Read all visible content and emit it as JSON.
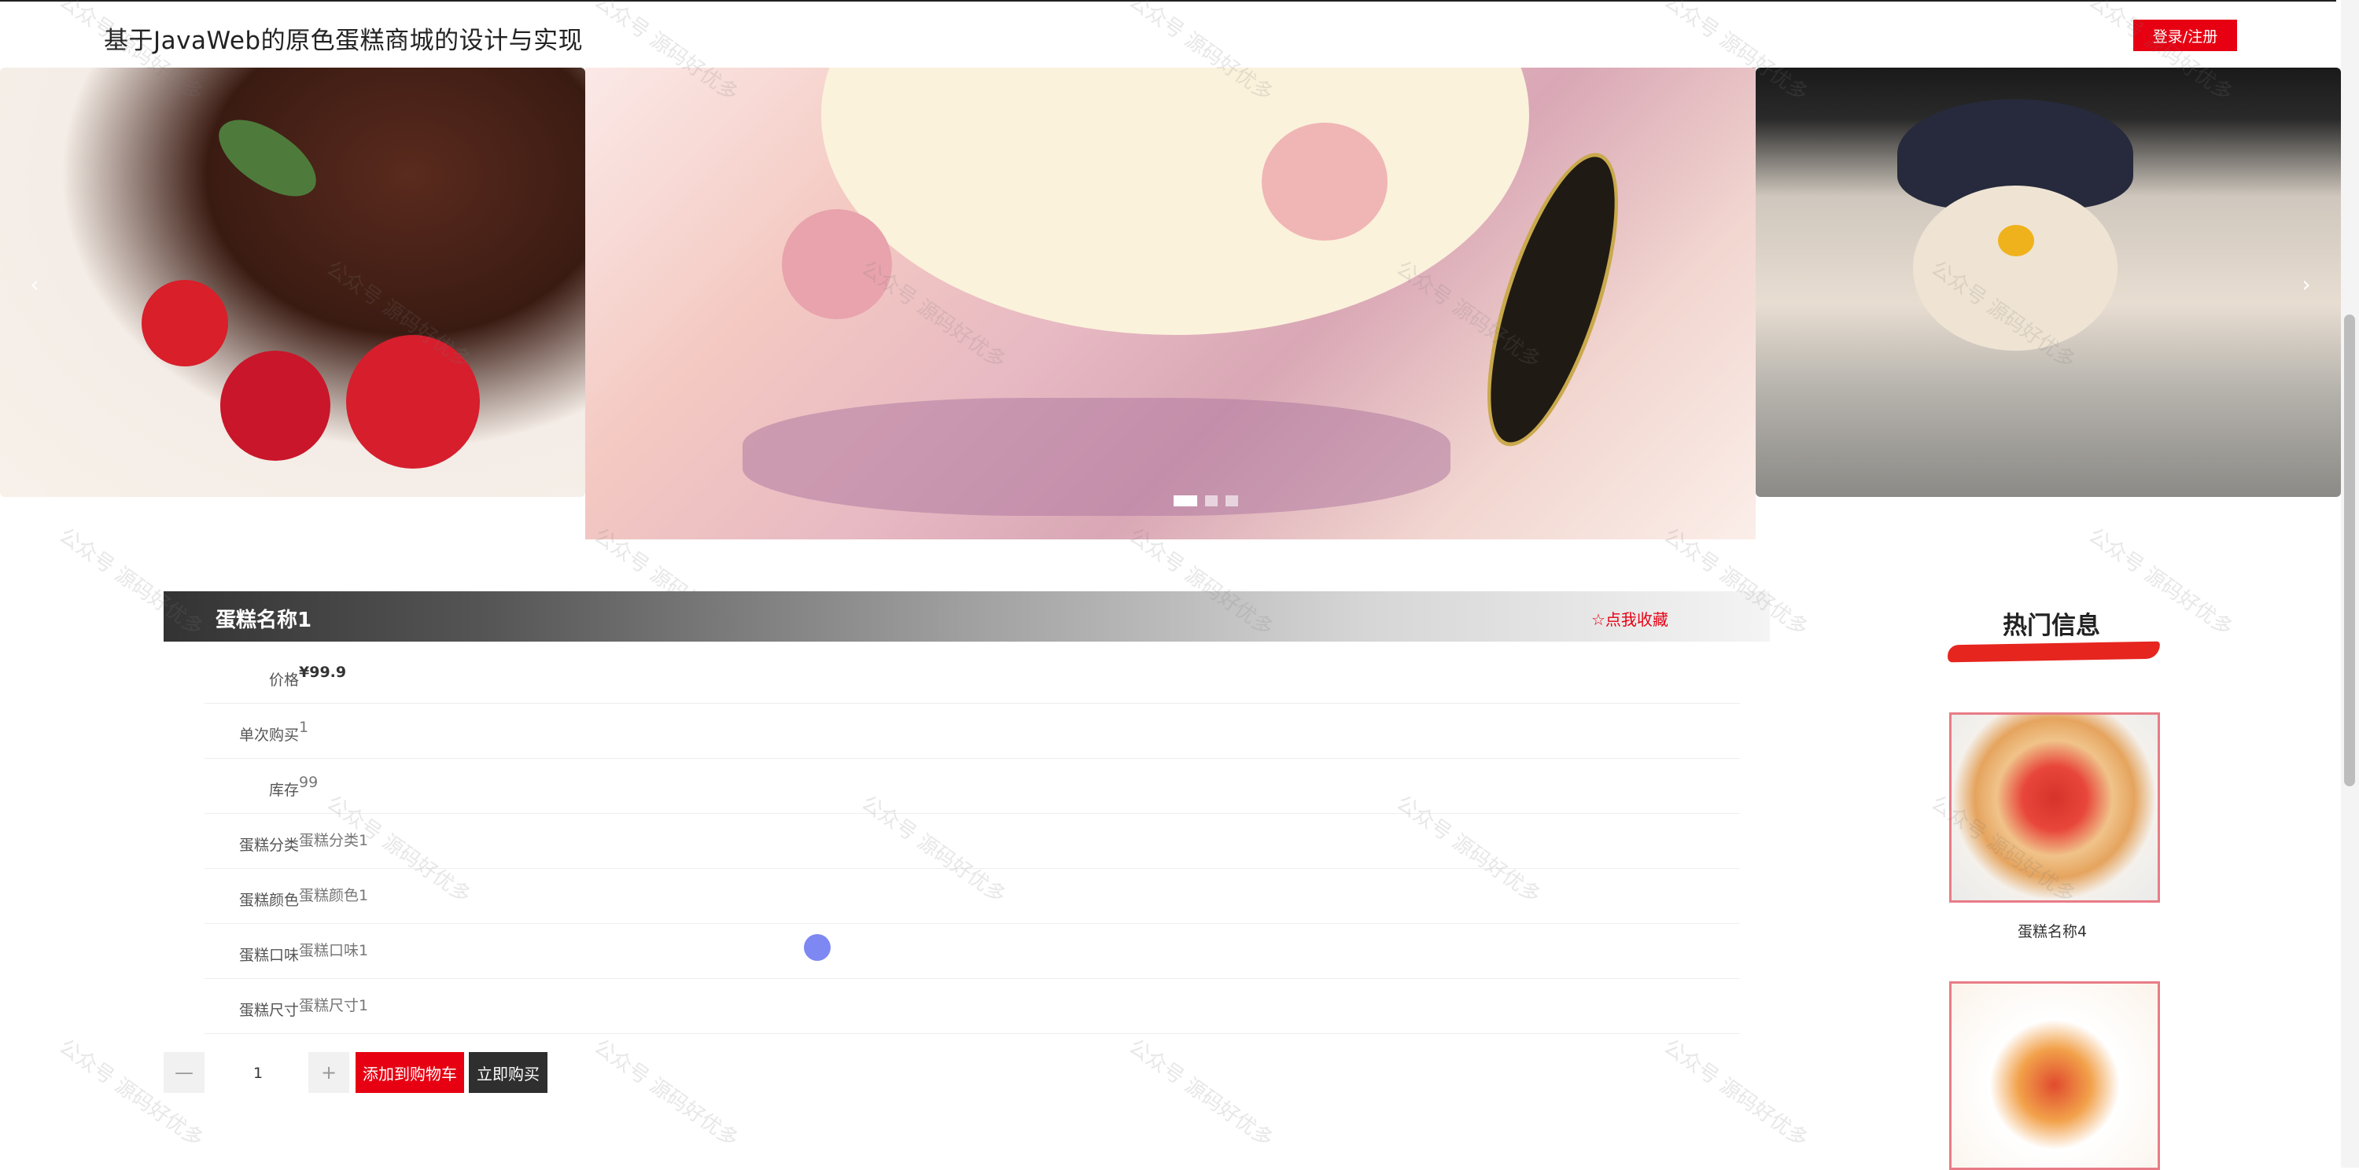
{
  "header": {
    "site_title": "基于JavaWeb的原色蛋糕商城的设计与实现",
    "login_label": "登录/注册"
  },
  "carousel": {
    "prev_glyph": "‹",
    "next_glyph": "›",
    "slide_count": 3,
    "active_index": 0
  },
  "product": {
    "name": "蛋糕名称1",
    "favorite_label": "☆点我收藏",
    "attributes": [
      {
        "label": "价格",
        "value": "¥99.9"
      },
      {
        "label": "单次购买",
        "value": "1"
      },
      {
        "label": "库存",
        "value": "99"
      },
      {
        "label": "蛋糕分类",
        "value": "蛋糕分类1"
      },
      {
        "label": "蛋糕颜色",
        "value": "蛋糕颜色1"
      },
      {
        "label": "蛋糕口味",
        "value": "蛋糕口味1"
      },
      {
        "label": "蛋糕尺寸",
        "value": "蛋糕尺寸1"
      }
    ]
  },
  "purchase": {
    "minus_label": "—",
    "plus_label": "+",
    "quantity": "1",
    "add_to_cart_label": "添加到购物车",
    "buy_now_label": "立即购买"
  },
  "hot": {
    "title": "热门信息",
    "items": [
      {
        "name": "蛋糕名称4"
      }
    ]
  },
  "watermark": {
    "text": "公众号 源码好优多"
  },
  "colors": {
    "accent": "#e60012",
    "dark_button": "#2f2f2f",
    "hot_border": "#e87c86"
  }
}
